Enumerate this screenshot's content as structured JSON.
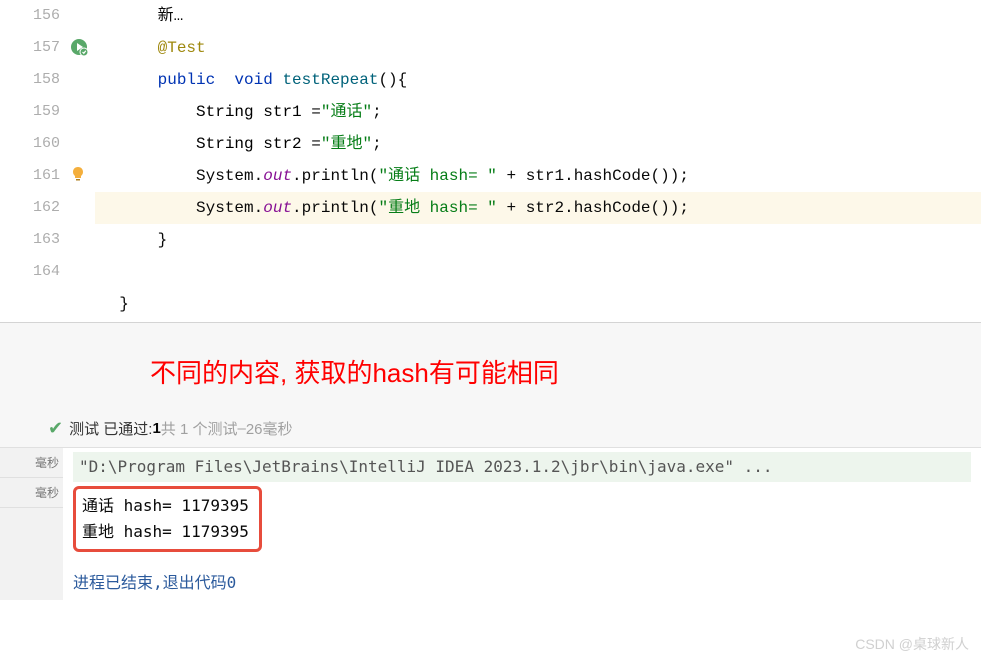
{
  "gutter": {
    "lines": [
      "156",
      "157",
      "158",
      "159",
      "160",
      "161",
      "162",
      "163",
      "164"
    ]
  },
  "code": {
    "l0_prefix": "新…",
    "l1_annotation": "@Test",
    "l2_kw1": "public",
    "l2_kw2": "void",
    "l2_method": "testRepeat",
    "l2_tail": "(){",
    "l3_type": "String",
    "l3_var": "str1",
    "l3_eq": " =",
    "l3_str": "\"通话\"",
    "l3_semi": ";",
    "l4_type": "String",
    "l4_var": "str2",
    "l4_eq": " =",
    "l4_str": "\"重地\"",
    "l4_semi": ";",
    "l5_sys": "System.",
    "l5_out": "out",
    "l5_print": ".println(",
    "l5_str": "\"通话 hash= \"",
    "l5_plus": " + str1.hashCode());",
    "l6_sys": "System.",
    "l6_out": "out",
    "l6_print": ".println(",
    "l6_str": "\"重地 hash= \"",
    "l6_plus": " + str2.hashCode());",
    "l7_brace": "}",
    "l9_brace": "}"
  },
  "annotation_text": "不同的内容, 获取的hash有可能相同",
  "test_bar": {
    "prefix": "测试 已通过: ",
    "count": "1",
    "total_text": "共 1 个测试",
    "dash": " – ",
    "time": "26毫秒"
  },
  "left_sidebar": {
    "cell1": "毫秒",
    "cell2": "毫秒"
  },
  "console": {
    "cmd": "\"D:\\Program Files\\JetBrains\\IntelliJ IDEA 2023.1.2\\jbr\\bin\\java.exe\" ...",
    "out1": "通话 hash= 1179395",
    "out2": "重地 hash= 1179395",
    "finish": "进程已结束,退出代码0"
  },
  "watermark": "CSDN @桌球新人"
}
